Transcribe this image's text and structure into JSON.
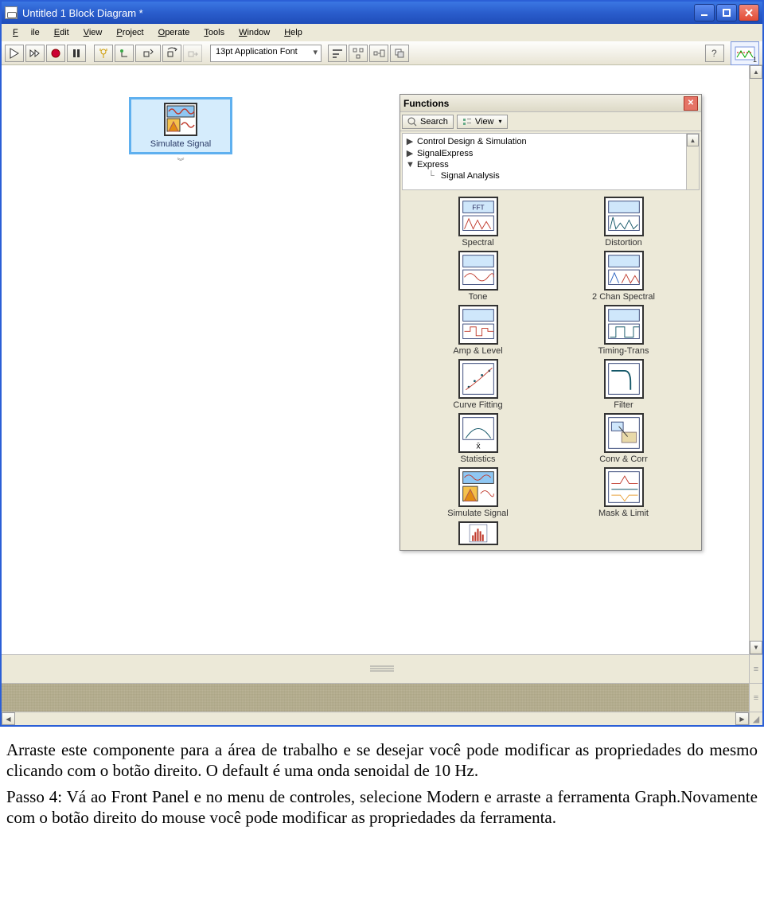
{
  "window": {
    "title": "Untitled 1 Block Diagram *"
  },
  "menu": {
    "file": "File",
    "edit": "Edit",
    "view": "View",
    "project": "Project",
    "operate": "Operate",
    "tools": "Tools",
    "window": "Window",
    "help": "Help"
  },
  "toolbar": {
    "font": "13pt Application Font",
    "corner_num": "1"
  },
  "sim_block": {
    "label": "Simulate Signal"
  },
  "palette": {
    "title": "Functions",
    "search": "Search",
    "view": "View",
    "tree": [
      {
        "exp": "▶",
        "label": "Control Design & Simulation"
      },
      {
        "exp": "▶",
        "label": "SignalExpress"
      },
      {
        "exp": "▼",
        "label": "Express"
      },
      {
        "exp": "",
        "label": "Signal Analysis"
      }
    ],
    "items": [
      {
        "label": "Spectral"
      },
      {
        "label": "Distortion"
      },
      {
        "label": "Tone"
      },
      {
        "label": "2 Chan Spectral"
      },
      {
        "label": "Amp & Level"
      },
      {
        "label": "Timing-Trans"
      },
      {
        "label": "Curve Fitting"
      },
      {
        "label": "Filter"
      },
      {
        "label": "Statistics"
      },
      {
        "label": "Conv & Corr"
      },
      {
        "label": "Simulate Signal"
      },
      {
        "label": "Mask & Limit"
      }
    ],
    "extra_item": {
      "label": ""
    }
  },
  "doc": {
    "p1": "Arraste este componente para a área de trabalho e se desejar você pode modificar as propriedades do mesmo clicando com o botão direito. O default é uma onda senoidal de 10 Hz.",
    "p2": "Passo 4: Vá ao Front Panel e no menu de controles, selecione Modern e arraste a ferramenta Graph.Novamente com o botão direito do mouse você pode modificar as propriedades da ferramenta."
  }
}
